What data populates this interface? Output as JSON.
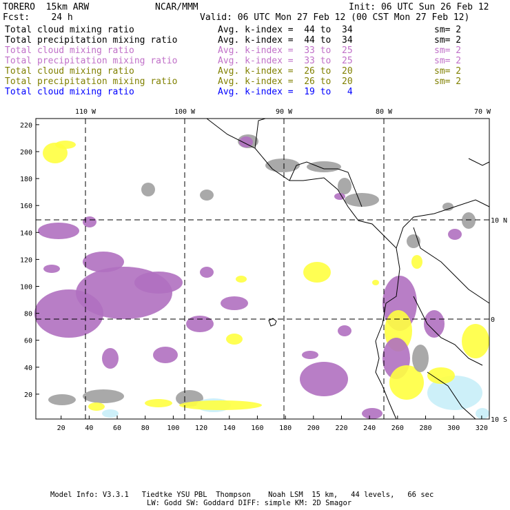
{
  "header": {
    "title": "TORERO  15km ARW",
    "org": "NCAR/MMM",
    "init": "Init: 06 UTC Sun 26 Feb 12",
    "fcst": "Fcst:    24 h",
    "valid": "Valid: 06 UTC Mon 27 Feb 12 (00 CST Mon 27 Feb 12)"
  },
  "legend": [
    {
      "field": "Total cloud mixing ratio",
      "range": "Avg. k-index =  44 to  34",
      "sm": "sm= 2",
      "color": "#000000"
    },
    {
      "field": "Total precipitation mixing ratio",
      "range": "Avg. k-index =  44 to  34",
      "sm": "sm= 2",
      "color": "#000000"
    },
    {
      "field": "Total cloud mixing ratio",
      "range": "Avg. k-index =  33 to  25",
      "sm": "sm= 2",
      "color": "#c070c8"
    },
    {
      "field": "Total precipitation mixing ratio",
      "range": "Avg. k-index =  33 to  25",
      "sm": "sm= 2",
      "color": "#c070c8"
    },
    {
      "field": "Total cloud mixing ratio",
      "range": "Avg. k-index =  26 to  20",
      "sm": "sm= 2",
      "color": "#808000"
    },
    {
      "field": "Total precipitation mixing ratio",
      "range": "Avg. k-index =  26 to  20",
      "sm": "sm= 2",
      "color": "#808000"
    },
    {
      "field": "Total cloud mixing ratio",
      "range": "Avg. k-index =  19 to   4",
      "sm": "",
      "color": "#0000ff"
    }
  ],
  "map": {
    "lon_labels": [
      "110 W",
      "100 W",
      "90 W",
      "80 W",
      "70 W"
    ],
    "lat_labels": [
      "10 N",
      "0",
      "10 S"
    ],
    "x_ticks": [
      "20",
      "40",
      "60",
      "80",
      "100",
      "120",
      "140",
      "160",
      "180",
      "200",
      "220",
      "240",
      "260",
      "280",
      "300",
      "320"
    ],
    "y_ticks": [
      "20",
      "40",
      "60",
      "80",
      "100",
      "120",
      "140",
      "160",
      "180",
      "200",
      "220"
    ],
    "colors": {
      "grey": "#a0a0a0",
      "purple": "#b070c0",
      "yellow": "#ffff40",
      "lightblue": "#c8eef8"
    }
  },
  "footer": {
    "line1": "Model Info: V3.3.1   Tiedtke YSU PBL  Thompson    Noah LSM  15 km,   44 levels,   66 sec",
    "line2": "LW: Godd SW: Goddard DIFF: simple KM: 2D Smagor"
  }
}
